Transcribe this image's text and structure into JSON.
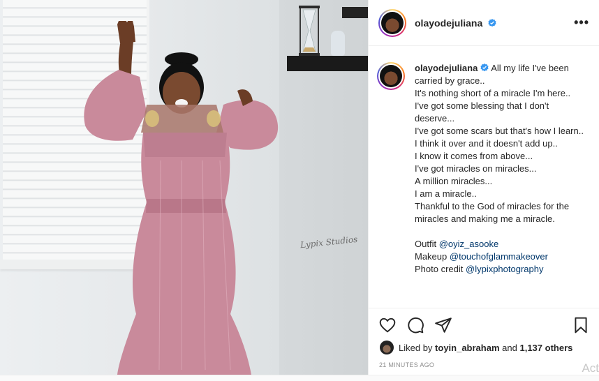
{
  "post": {
    "username": "olayodejuliana",
    "verified": true,
    "caption_lines": [
      "All my life I've been carried by grace..",
      "It's nothing short of a miracle I'm here..",
      "I've got some blessing that I don't deserve...",
      "I've got some scars but that's how I learn..",
      "I think it over and it doesn't add up..",
      "I know it comes from above...",
      "I've got miracles on miracles...",
      "A million miracles...",
      "I am a miracle..",
      "Thankful to the God of miracles for the miracles and making me a miracle."
    ],
    "credits": [
      {
        "label": "Outfit",
        "handle": "@oyiz_asooke"
      },
      {
        "label": "Makeup",
        "handle": "@touchofglammakeover"
      },
      {
        "label": "Photo credit",
        "handle": "@lypixphotography"
      }
    ],
    "liked_by_prefix": "Liked by",
    "liked_by_user": "toyin_abraham",
    "liked_by_and": "and",
    "liked_by_others": "1,137 others",
    "timestamp": "21 MINUTES AGO",
    "watermark": "Lypix Studios"
  },
  "icons": {
    "more": "more-options-icon",
    "like": "heart-icon",
    "comment": "comment-icon",
    "share": "paper-plane-icon",
    "save": "bookmark-icon",
    "verified": "verified-badge-icon"
  },
  "overlay": {
    "activate_text": "Act"
  },
  "colors": {
    "text": "#262626",
    "link": "#00376b",
    "muted": "#8e8e8e",
    "verified": "#3897f0",
    "dress": "#c98a9b"
  }
}
